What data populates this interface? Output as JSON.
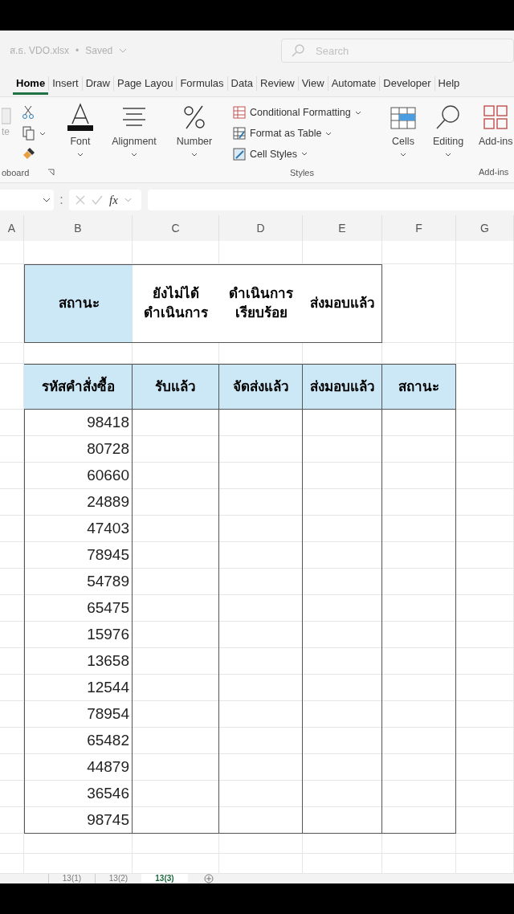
{
  "title_bar": {
    "filename": "ส.ธ. VDO.xlsx",
    "separator": "•",
    "status": "Saved",
    "search": {
      "placeholder": "Search"
    }
  },
  "tabs": [
    {
      "label": "Home",
      "selected": true
    },
    {
      "label": "Insert",
      "selected": false
    },
    {
      "label": "Draw",
      "selected": false
    },
    {
      "label": "Page Layou",
      "selected": false
    },
    {
      "label": "Formulas",
      "selected": false
    },
    {
      "label": "Data",
      "selected": false
    },
    {
      "label": "Review",
      "selected": false
    },
    {
      "label": "View",
      "selected": false
    },
    {
      "label": "Automate",
      "selected": false
    },
    {
      "label": "Developer",
      "selected": false
    },
    {
      "label": "Help",
      "selected": false
    }
  ],
  "ribbon": {
    "clipboard": {
      "paste_label": "te",
      "group_label": "oboard"
    },
    "big_buttons": [
      {
        "kind": "font",
        "label": "Font"
      },
      {
        "kind": "alignment",
        "label": "Alignment"
      },
      {
        "kind": "number",
        "label": "Number"
      }
    ],
    "styles": {
      "items": [
        "Conditional Formatting",
        "Format as Table",
        "Cell Styles"
      ],
      "group_label": "Styles"
    },
    "cells": {
      "label": "Cells"
    },
    "editing": {
      "label": "Editing"
    },
    "addins": {
      "label": "Add-ins",
      "group_label": "Add-ins"
    }
  },
  "formula_bar": {
    "fx": "fx"
  },
  "columns": [
    "A",
    "B",
    "C",
    "D",
    "E",
    "F",
    "G"
  ],
  "status_table": {
    "header": "สถานะ",
    "items": [
      "ยังไม่ได้\nดำเนินการ",
      "ดำเนินการ\nเรียบร้อย",
      "ส่งมอบแล้ว"
    ]
  },
  "orders_table": {
    "columns": [
      "รหัสคำสั่งซื้อ",
      "รับแล้ว",
      "จัดส่งแล้ว",
      "ส่งมอบแล้ว",
      "สถานะ"
    ],
    "rows": [
      "98418",
      "80728",
      "60660",
      "24889",
      "47403",
      "78945",
      "54789",
      "65475",
      "15976",
      "13658",
      "12544",
      "78954",
      "65482",
      "44879",
      "36546",
      "98745"
    ]
  },
  "sheet_tabs": [
    {
      "label": "13(1)",
      "selected": false
    },
    {
      "label": "13(2)",
      "selected": false
    },
    {
      "label": "13(3)",
      "selected": true
    }
  ]
}
